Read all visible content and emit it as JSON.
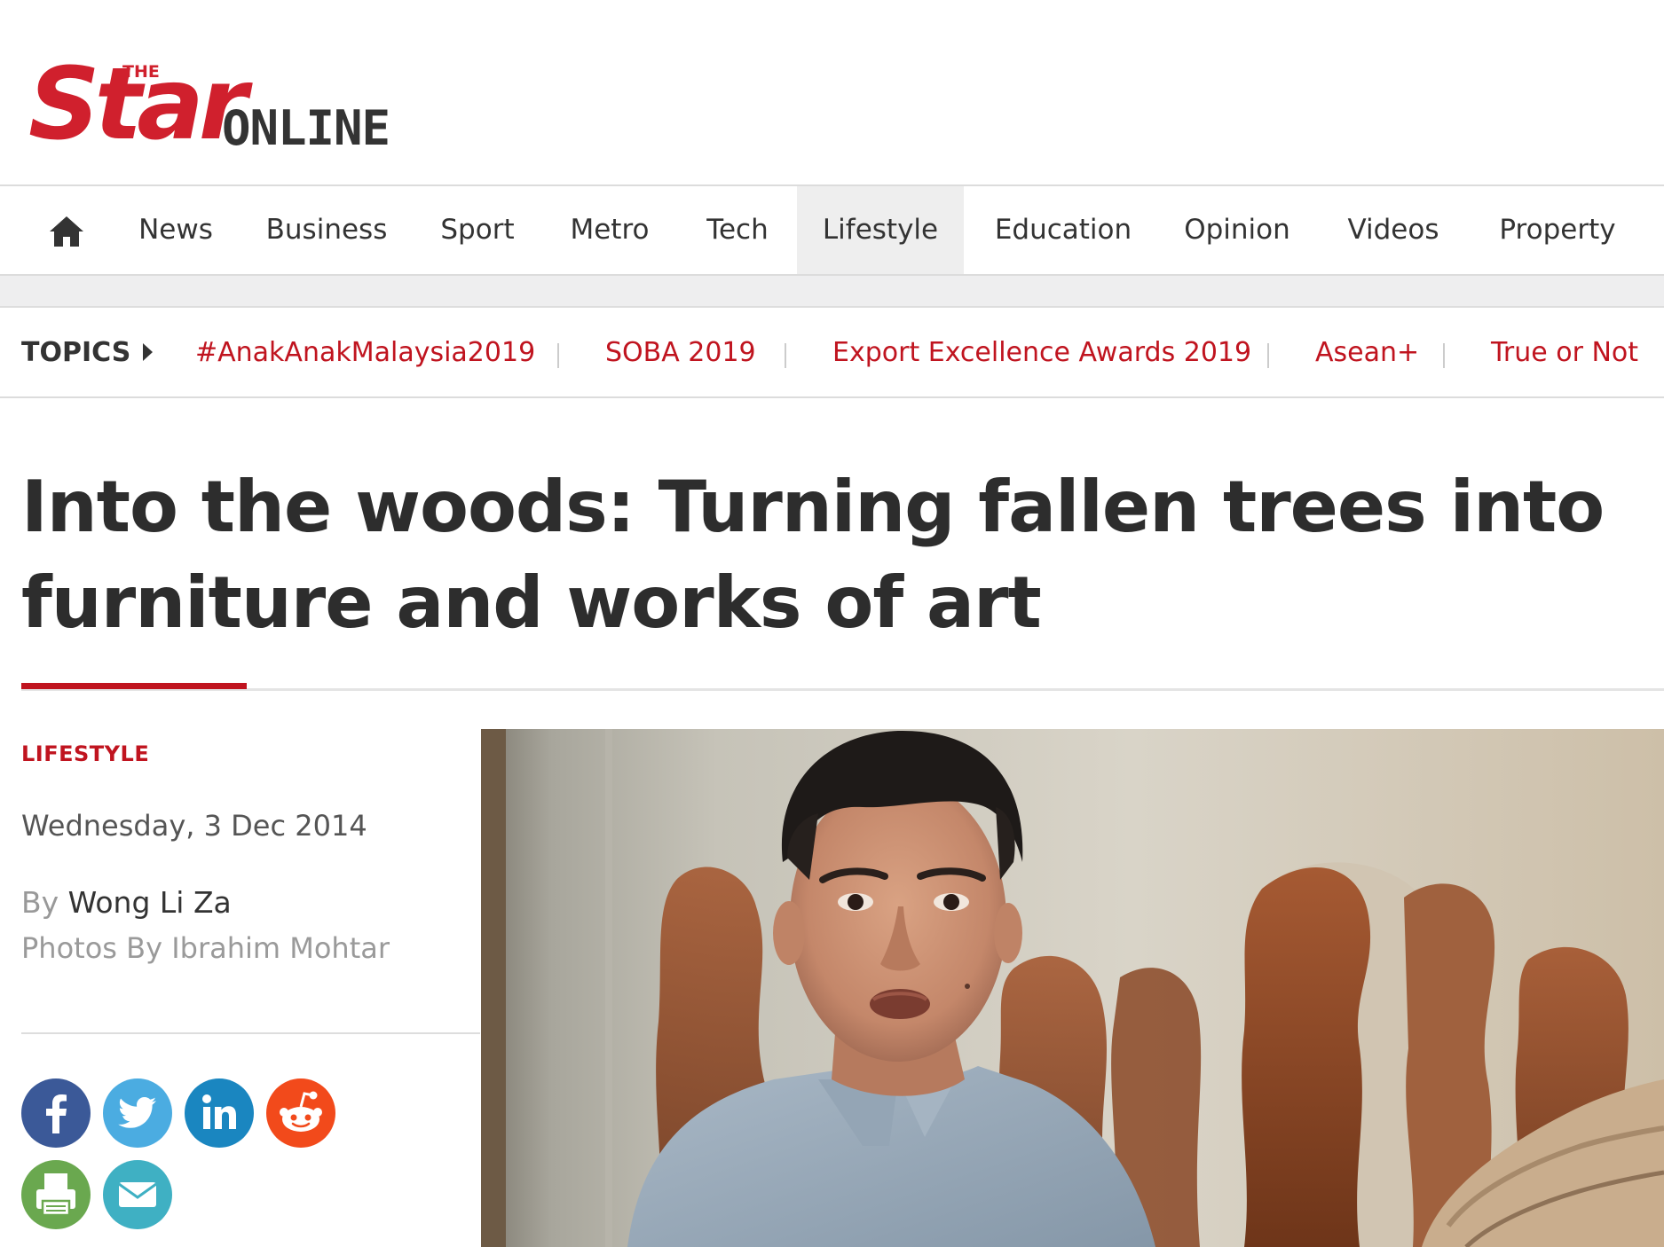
{
  "logo": {
    "the": "THE",
    "star": "Star",
    "online": "ONLINE"
  },
  "nav": {
    "home_icon": "home-icon",
    "items": [
      "News",
      "Business",
      "Sport",
      "Metro",
      "Tech",
      "Lifestyle",
      "Education",
      "Opinion",
      "Videos",
      "Property"
    ],
    "active": "Lifestyle"
  },
  "topics": {
    "label": "TOPICS",
    "items": [
      "#AnakAnakMalaysia2019",
      "SOBA 2019",
      "Export Excellence Awards 2019",
      "Asean+",
      "True or Not"
    ]
  },
  "article": {
    "headline_line1": "Into the woods: Turning fallen trees into",
    "headline_line2": "furniture and works of art",
    "category": "LIFESTYLE",
    "date": "Wednesday, 3 Dec 2014",
    "by_prefix": "By",
    "author": "Wong Li Za",
    "photos_credit": "Photos By Ibrahim Mohtar"
  },
  "share": {
    "buttons": [
      {
        "icon": "facebook-icon",
        "color": "#3b5998"
      },
      {
        "icon": "twitter-icon",
        "color": "#4bace1"
      },
      {
        "icon": "linkedin-icon",
        "color": "#1a86c0"
      },
      {
        "icon": "reddit-icon",
        "color": "#f24a1b"
      },
      {
        "icon": "print-icon",
        "color": "#6aa84f"
      },
      {
        "icon": "email-icon",
        "color": "#3fb0c3"
      }
    ]
  },
  "colors": {
    "brand_red": "#d0202d",
    "link_red": "#c0141f",
    "text_dark": "#333333"
  }
}
